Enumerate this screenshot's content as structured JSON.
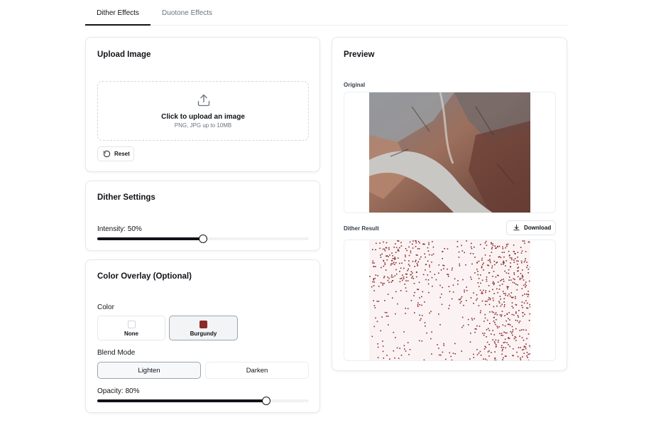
{
  "tabs": [
    {
      "label": "Dither Effects",
      "active": true
    },
    {
      "label": "Duotone Effects",
      "active": false
    }
  ],
  "upload": {
    "title": "Upload Image",
    "icon": "upload-icon",
    "prompt": "Click to upload an image",
    "hint": "PNG, JPG up to 10MB",
    "reset_label": "Reset"
  },
  "dither_settings": {
    "title": "Dither Settings",
    "intensity_label": "Intensity: 50%",
    "intensity_value": 50
  },
  "color_overlay": {
    "title": "Color Overlay (Optional)",
    "color_label": "Color",
    "colors": [
      {
        "name": "None",
        "hex": "#ffffff",
        "selected": false
      },
      {
        "name": "Burgundy",
        "hex": "#8b2a2a",
        "selected": true
      }
    ],
    "blend_label": "Blend Mode",
    "blend_modes": [
      {
        "label": "Lighten",
        "selected": true
      },
      {
        "label": "Darken",
        "selected": false
      }
    ],
    "opacity_label": "Opacity: 80%",
    "opacity_value": 80
  },
  "preview": {
    "title": "Preview",
    "original_label": "Original",
    "result_label": "Dither Result",
    "download_label": "Download"
  },
  "colors": {
    "accent": "#111318",
    "burgundy": "#8b2a2a"
  }
}
